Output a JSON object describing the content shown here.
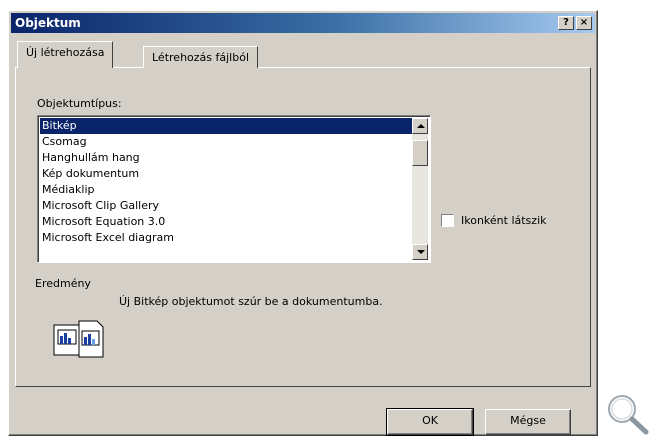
{
  "window": {
    "title": "Objektum",
    "help_button": "?",
    "close_button": "×"
  },
  "tabs": [
    {
      "label": "Új létrehozása",
      "active": true
    },
    {
      "label": "Létrehozás fájlból",
      "active": false
    }
  ],
  "object_type": {
    "label": "Objektumtípus:",
    "items": [
      "Bitkép",
      "Csomag",
      "Hanghullám hang",
      "Kép dokumentum",
      "Médiaklip",
      "Microsoft Clip Gallery",
      "Microsoft Equation 3.0",
      "Microsoft Excel diagram"
    ],
    "selected_index": 0
  },
  "display_as_icon": {
    "label": "Ikonként látszik",
    "checked": false
  },
  "result": {
    "label": "Eredmény",
    "text": "Új Bitkép objektumot szúr be a dokumentumba."
  },
  "buttons": {
    "ok": "OK",
    "cancel": "Mégse"
  },
  "icons": {
    "result": "bitmap-document-icon",
    "zoom": "magnifier-icon"
  }
}
